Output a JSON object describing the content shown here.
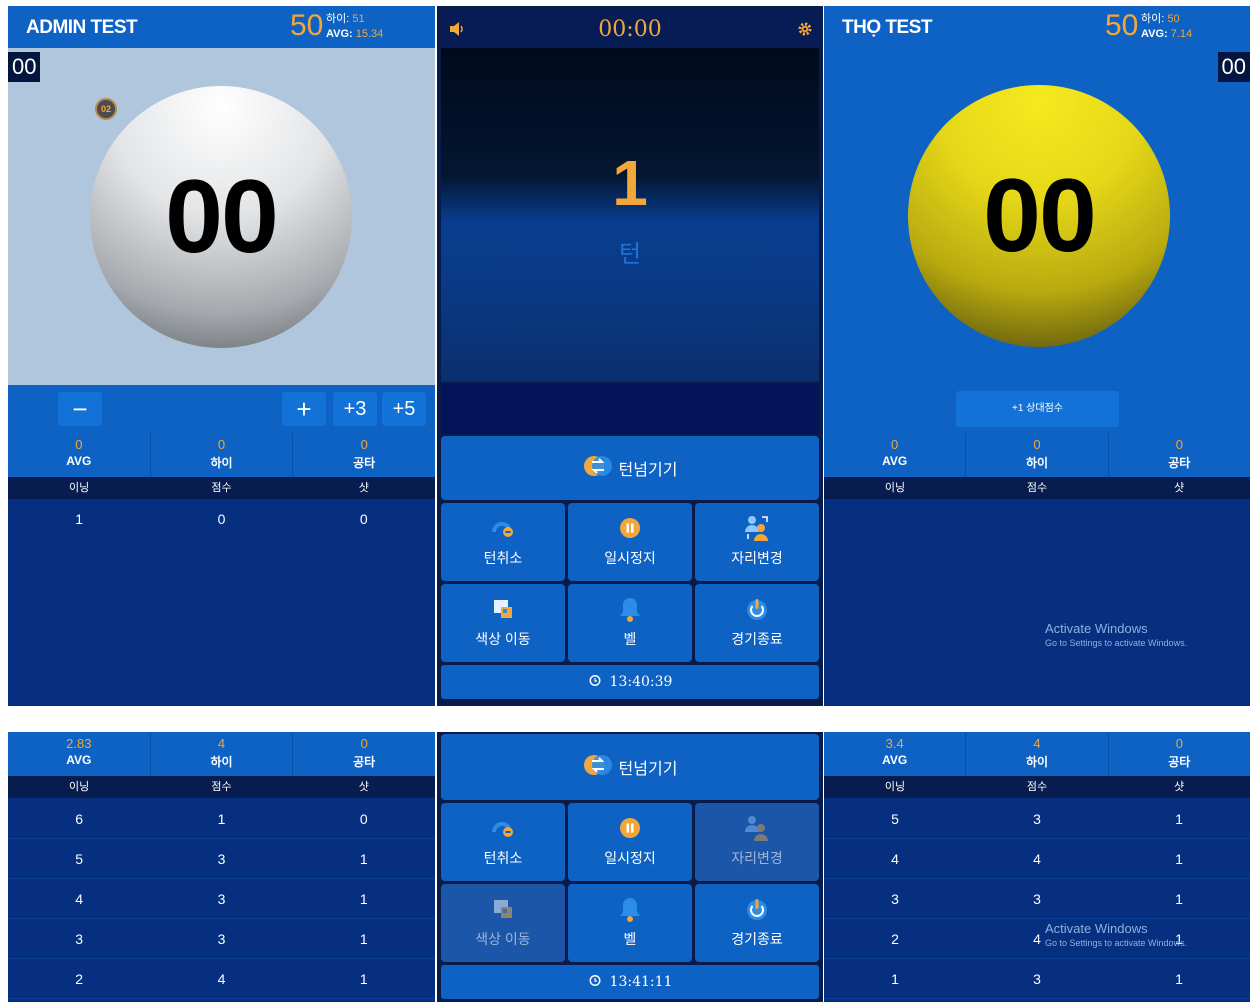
{
  "top": {
    "left_player": {
      "name": "ADMIN TEST",
      "target": "50",
      "high": "51",
      "avg": "15.34",
      "corner_score": "00",
      "ball_score": "00",
      "ball_badge": "02",
      "controls": {
        "minus": "−",
        "plus": "+",
        "plus3": "+3",
        "plus5": "+5"
      },
      "stats": {
        "avg_value": "0",
        "avg_label": "AVG",
        "high_value": "0",
        "high_label": "하이",
        "miss_value": "0",
        "miss_label": "공타"
      },
      "table_headers": [
        "이닝",
        "점수",
        "샷"
      ],
      "rows": [
        [
          "1",
          "0",
          "0"
        ]
      ]
    },
    "center": {
      "timer": "00:00",
      "turn_number": "1",
      "turn_label": "턴",
      "turn_pass_label": "턴넘기기",
      "buttons": [
        {
          "label": "턴취소",
          "icon": "undo-turn-icon"
        },
        {
          "label": "일시정지",
          "icon": "pause-icon"
        },
        {
          "label": "자리변경",
          "icon": "swap-seat-icon"
        },
        {
          "label": "색상 이동",
          "icon": "color-move-icon"
        },
        {
          "label": "벨",
          "icon": "bell-icon"
        },
        {
          "label": "경기종료",
          "icon": "power-icon"
        }
      ],
      "clock": "13:40:39"
    },
    "right_player": {
      "name": "THỌ TEST",
      "target": "50",
      "high": "50",
      "avg": "7.14",
      "corner_score": "00",
      "ball_score": "00",
      "opponent_button": "+1 상대점수",
      "stats": {
        "avg_value": "0",
        "avg_label": "AVG",
        "high_value": "0",
        "high_label": "하이",
        "miss_value": "0",
        "miss_label": "공타"
      },
      "table_headers": [
        "이닝",
        "점수",
        "샷"
      ]
    },
    "watermark": {
      "title": "Activate Windows",
      "subtitle": "Go to Settings to activate Windows."
    }
  },
  "bottom": {
    "left_player": {
      "stats": {
        "avg_value": "2.83",
        "avg_label": "AVG",
        "high_value": "4",
        "high_label": "하이",
        "miss_value": "0",
        "miss_label": "공타"
      },
      "table_headers": [
        "이닝",
        "점수",
        "샷"
      ],
      "rows": [
        [
          "6",
          "1",
          "0"
        ],
        [
          "5",
          "3",
          "1"
        ],
        [
          "4",
          "3",
          "1"
        ],
        [
          "3",
          "3",
          "1"
        ],
        [
          "2",
          "4",
          "1"
        ]
      ]
    },
    "center": {
      "turn_pass_label": "턴넘기기",
      "buttons": [
        "턴취소",
        "일시정지",
        "자리변경",
        "색상 이동",
        "벨",
        "경기종료"
      ],
      "clock": "13:41:11"
    },
    "right_player": {
      "stats": {
        "avg_value": "3.4",
        "avg_label": "AVG",
        "high_value": "4",
        "high_label": "하이",
        "miss_value": "0",
        "miss_label": "공타"
      },
      "table_headers": [
        "이닝",
        "점수",
        "샷"
      ],
      "rows": [
        [
          "5",
          "3",
          "1"
        ],
        [
          "4",
          "4",
          "1"
        ],
        [
          "3",
          "3",
          "1"
        ],
        [
          "2",
          "4",
          "1"
        ],
        [
          "1",
          "3",
          "1"
        ]
      ]
    },
    "watermark": {
      "title": "Activate Windows",
      "subtitle": "Go to Settings to activate Windows."
    }
  },
  "colors": {
    "accent_orange": "#f3a63a",
    "panel_blue": "#0e62c4",
    "panel_dark": "#062f80",
    "ball_yellow": "#f0e21b",
    "ball_white": "#f2f4f6"
  }
}
